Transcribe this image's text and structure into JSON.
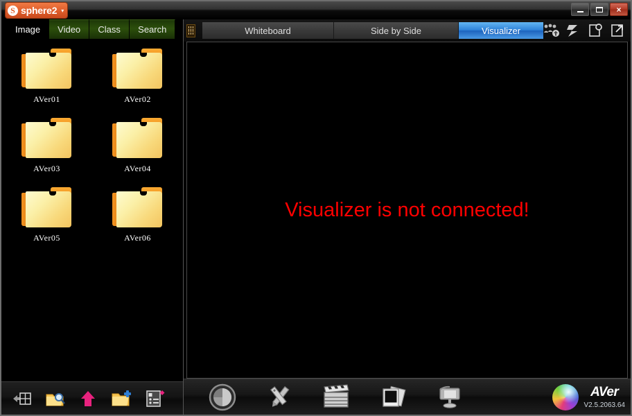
{
  "window": {
    "logo_mark": "S",
    "logo_text": "sphere2",
    "caret": "▾",
    "minimize_label": "Minimize",
    "maximize_label": "Maximize",
    "close_label": "×"
  },
  "sidebar": {
    "tabs": [
      {
        "label": "Image",
        "active": true
      },
      {
        "label": "Video",
        "active": false
      },
      {
        "label": "Class",
        "active": false
      },
      {
        "label": "Search",
        "active": false
      }
    ],
    "folders": [
      {
        "label": "AVer01"
      },
      {
        "label": "AVer02"
      },
      {
        "label": "AVer03"
      },
      {
        "label": "AVer04"
      },
      {
        "label": "AVer05"
      },
      {
        "label": "AVer06"
      }
    ],
    "toolbar": [
      {
        "icon": "panel-layout-icon"
      },
      {
        "icon": "folder-search-icon"
      },
      {
        "icon": "upload-arrow-icon"
      },
      {
        "icon": "add-folder-icon"
      },
      {
        "icon": "list-edit-icon"
      }
    ]
  },
  "main": {
    "grid_icon": "grid-view-icon",
    "view_tabs": [
      {
        "label": "Whiteboard",
        "active": false
      },
      {
        "label": "Side by Side",
        "active": false
      },
      {
        "label": "Visualizer",
        "active": true
      }
    ],
    "top_icons": [
      {
        "icon": "group-upload-icon"
      },
      {
        "icon": "z-tool-icon"
      },
      {
        "icon": "page-search-icon"
      },
      {
        "icon": "open-external-icon"
      }
    ],
    "message": "Visualizer is not connected!",
    "message_color": "#ff0000",
    "toolbar": [
      {
        "icon": "capture-icon"
      },
      {
        "icon": "annotate-tools-icon"
      },
      {
        "icon": "clapperboard-icon"
      },
      {
        "icon": "photos-stack-icon"
      },
      {
        "icon": "visualizer-device-icon"
      }
    ],
    "brand": {
      "logo": "aver-sphere-icon",
      "name": "AVer",
      "version": "V2.5.2063.64"
    }
  }
}
